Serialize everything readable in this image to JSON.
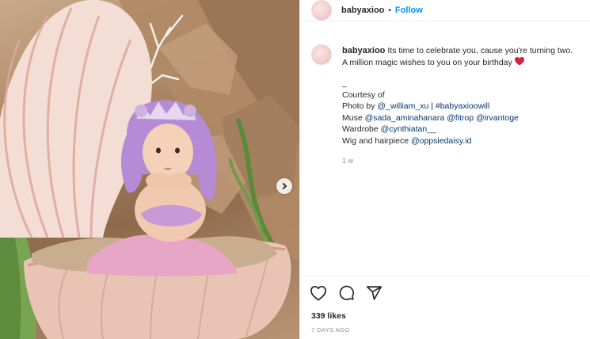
{
  "post": {
    "username": "babyaxioo",
    "dot": "•",
    "follow_label": "Follow",
    "caption_lines": [
      "Its time to celebrate you, cause you're turning two.",
      "A million magic wishes to you on your birthday"
    ],
    "underscore": "_",
    "courtesy": "Courtesy of",
    "credits": {
      "photo_prefix": "Photo by ",
      "photo_mention": "@_william_xu",
      "photo_sep": " | ",
      "photo_tag": "#babyaxioowill",
      "muse_prefix": "Muse ",
      "muse_mention1": "@sada_aminahanara",
      "muse_mention2": "@fitrop",
      "muse_mention3": "@irvantoge",
      "wardrobe_prefix": "Wardrobe ",
      "wardrobe_mention": "@cynthiatan__",
      "wig_prefix": "Wig and hairpiece ",
      "wig_mention": "@oppsiedaisy.id"
    },
    "comment_age": "1 w",
    "likes": "339 likes",
    "posted": "7 DAYS AGO"
  },
  "icons": {
    "like": "heart-outline-icon",
    "comment": "comment-bubble-icon",
    "share": "paper-plane-icon",
    "next": "chevron-right-icon",
    "emoji": "red-heart-emoji"
  },
  "colors": {
    "link": "#00376b",
    "follow": "#0095f6",
    "muted": "#8e8e8e",
    "text": "#262626",
    "emoji_heart": "#d6213c"
  }
}
